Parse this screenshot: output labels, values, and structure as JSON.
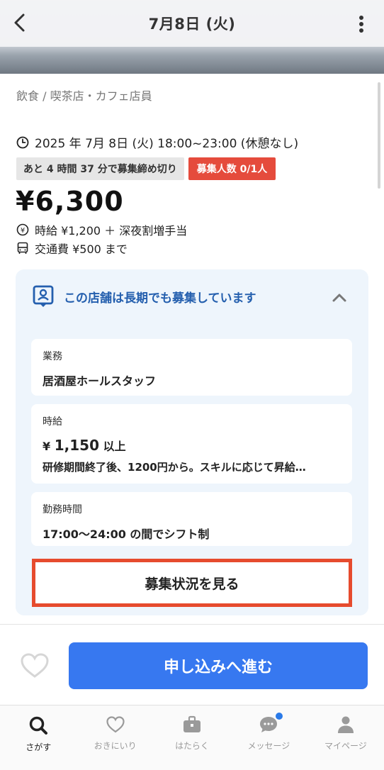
{
  "header": {
    "title": "7月8日 (火)"
  },
  "job": {
    "category": "飲食 / 喫茶店・カフェ店員",
    "datetime": "2025 年 7月 8日 (火) 18:00~23:00 (休憩なし)",
    "deadline_tag": "あと 4 時間 37 分で募集締め切り",
    "recruit_tag": "募集人数 0/1人",
    "price": "¥6,300",
    "hourly": "時給 ¥1,200 ＋ 深夜割増手当",
    "transport": "交通費 ¥500 まで"
  },
  "long_term": {
    "heading": "この店舗は長期でも募集しています",
    "items": [
      {
        "label": "業務",
        "value": "居酒屋ホールスタッフ"
      },
      {
        "label": "時給",
        "yen": "¥",
        "amount": "1,150",
        "suffix": "以上",
        "note": "研修期間終了後、1200円から。スキルに応じて昇給…"
      },
      {
        "label": "勤務時間",
        "value": "17:00～24:00 の間でシフト制"
      }
    ],
    "status_button": "募集状況を見る"
  },
  "footer": {
    "apply_button": "申し込みへ進む"
  },
  "tabs": [
    {
      "label": "さがす",
      "icon": "search-icon",
      "active": true
    },
    {
      "label": "おきにいり",
      "icon": "heart-icon",
      "active": false
    },
    {
      "label": "はたらく",
      "icon": "briefcase-icon",
      "active": false
    },
    {
      "label": "メッセージ",
      "icon": "chat-icon",
      "active": false
    },
    {
      "label": "マイページ",
      "icon": "user-icon",
      "active": false
    }
  ],
  "colors": {
    "accent_blue": "#3778f0",
    "heading_blue": "#245fae",
    "tag_red": "#e54b3c",
    "highlight_border": "#e64b2e",
    "notification_dot": "#2a7ae8"
  }
}
